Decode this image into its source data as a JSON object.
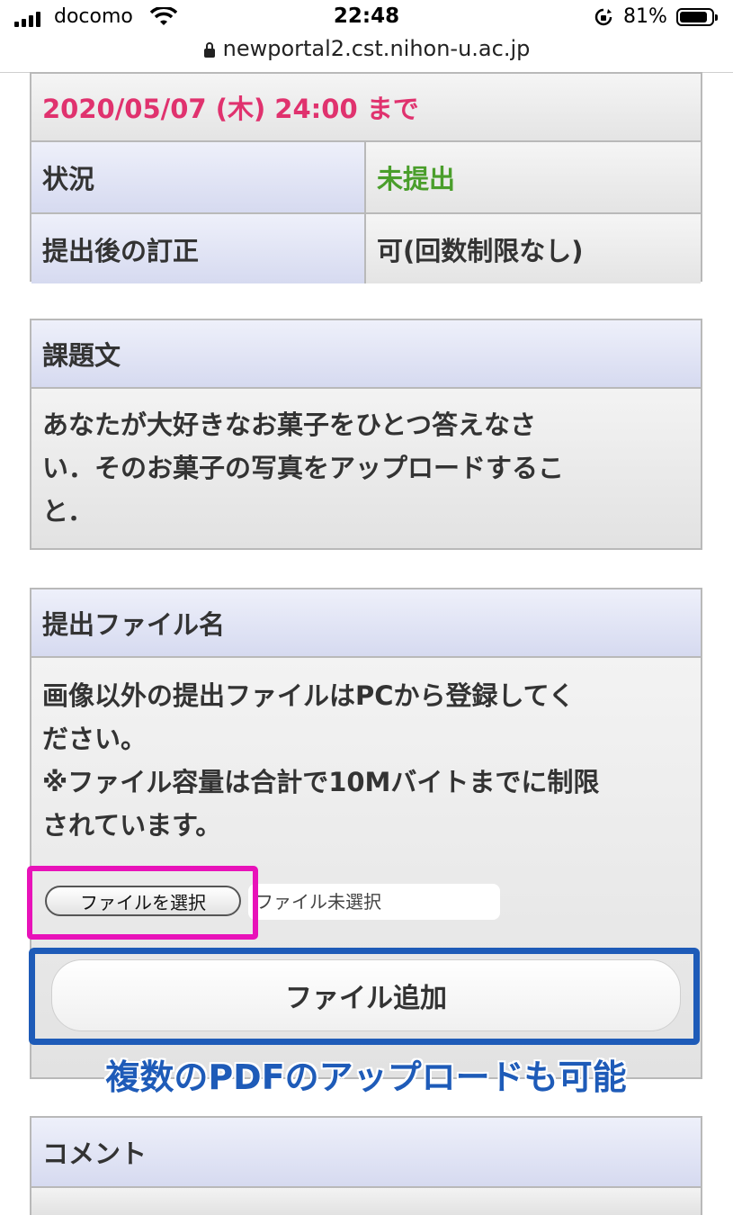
{
  "status_bar": {
    "carrier": "docomo",
    "time": "22:48",
    "battery": "81%"
  },
  "browser": {
    "url": "newportal2.cst.nihon-u.ac.jp"
  },
  "summary": {
    "deadline": "2020/05/07 (木) 24:00 まで",
    "rows": [
      {
        "label": "状況",
        "value": "未提出"
      },
      {
        "label": "提出後の訂正",
        "value": "可(回数制限なし)"
      }
    ],
    "status_color": "#4a9e2b",
    "deadline_color": "#e0326e"
  },
  "assignment": {
    "heading": "課題文",
    "lines": [
      "あなたが大好きなお菓子をひとつ答えなさ",
      "い．そのお菓子の写真をアップロードするこ",
      "と．"
    ]
  },
  "submission": {
    "heading": "提出ファイル名",
    "lines": [
      "画像以外の提出ファイルはPCから登録してく",
      "ださい。",
      "※ファイル容量は合計で10Mバイトまでに制限",
      "されています。"
    ],
    "choose_file_label": "ファイルを選択",
    "no_file_text": "ファイル未選択",
    "add_file_label": "ファイル追加"
  },
  "annotation": {
    "caption": "複数のPDFのアップロードも可能",
    "magenta": "#e812b9",
    "blue": "#1e5bb8"
  },
  "comment": {
    "heading": "コメント"
  }
}
